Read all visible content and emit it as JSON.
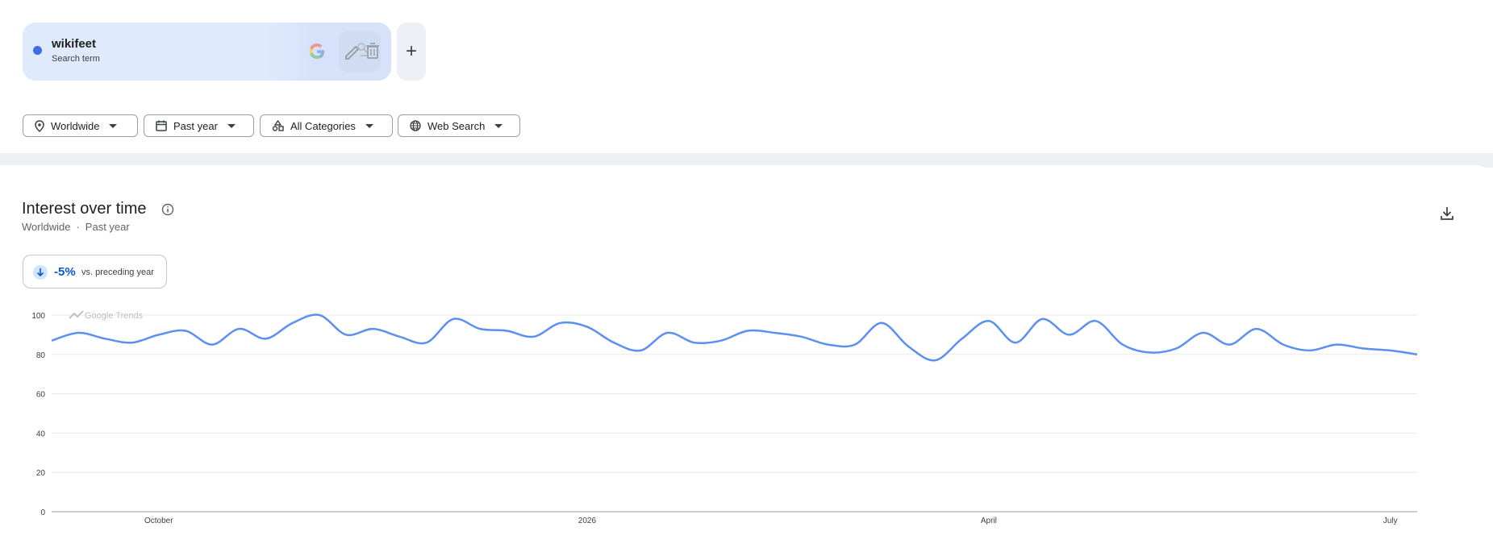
{
  "search_term": {
    "name": "wikifeet",
    "type": "Search term",
    "color": "#3b6ee0"
  },
  "add_label": "+",
  "filters": {
    "location": "Worldwide",
    "time": "Past year",
    "category": "All Categories",
    "search_type": "Web Search"
  },
  "section": {
    "title": "Interest over time",
    "sub_location": "Worldwide",
    "sub_dot": "·",
    "sub_time": "Past year"
  },
  "delta": {
    "value": "-5%",
    "label": "vs. preceding year"
  },
  "watermark": "Google Trends",
  "icons": [
    "google-g-icon",
    "edit-icon",
    "search-icon",
    "trash-icon",
    "location-pin-icon",
    "calendar-icon",
    "categories-icon",
    "globe-icon",
    "info-icon",
    "download-icon",
    "arrow-down-icon",
    "trends-icon"
  ],
  "chart_data": {
    "type": "line",
    "title": "",
    "xlabel": "",
    "ylabel": "",
    "ylim": [
      0,
      100
    ],
    "yticks": [
      0,
      20,
      40,
      60,
      80,
      100
    ],
    "xtick_labels": [
      {
        "label": "October",
        "index": 4
      },
      {
        "label": "2026",
        "index": 20
      },
      {
        "label": "April",
        "index": 35
      },
      {
        "label": "July",
        "index": 50
      }
    ],
    "series": [
      {
        "color": "#5b8ff0",
        "values": [
          87,
          91,
          88,
          86,
          90,
          92,
          85,
          93,
          88,
          96,
          100,
          90,
          93,
          89,
          86,
          98,
          93,
          92,
          89,
          96,
          94,
          86,
          82,
          91,
          86,
          87,
          92,
          91,
          89,
          85,
          85,
          96,
          84,
          77,
          88,
          97,
          86,
          98,
          90,
          97,
          85,
          81,
          83,
          91,
          85,
          93,
          85,
          82,
          85,
          83,
          82,
          80
        ]
      }
    ],
    "grid": true,
    "legend": "none"
  }
}
